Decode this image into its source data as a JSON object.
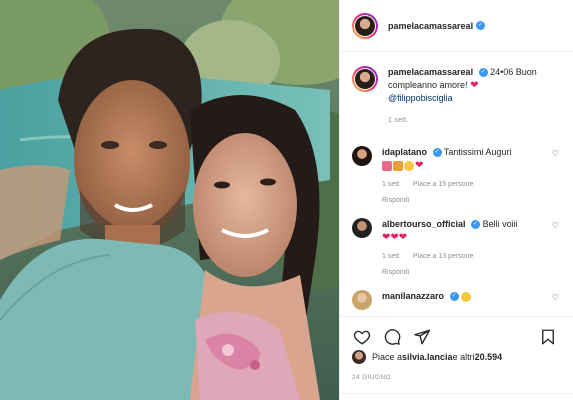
{
  "post": {
    "author": "pamelacamassareal",
    "caption_text": "24•06 Buon compleanno amore!",
    "caption_mention": "@filippobisciglia",
    "caption_age": "1 sett.",
    "likes_prefix": "Piace a ",
    "likes_user": "silvia.lancia",
    "likes_suffix": " e altri ",
    "likes_count": "20.594",
    "date": "24 GIUGNO"
  },
  "comments": [
    {
      "user": "idaplatano",
      "text": "Tantissimi Auguri",
      "age": "1 sett.",
      "likes": "Piace a 15 persone",
      "reply": "Rispondi"
    },
    {
      "user": "albertourso_official",
      "text": "Belli voiii",
      "age": "1 sett.",
      "likes": "Piace a 13 persone",
      "reply": "Rispondi"
    },
    {
      "user": "manilanazzaro",
      "text": ""
    }
  ],
  "icons": {
    "like": "heart-outline-icon",
    "comment": "speech-bubble-icon",
    "share": "paper-plane-icon",
    "save": "bookmark-icon",
    "verified": "verified-badge-icon"
  },
  "colors": {
    "verified": "#3897f0",
    "heart": "#e0245e",
    "link": "#00376b",
    "muted": "#8e8e8e"
  }
}
